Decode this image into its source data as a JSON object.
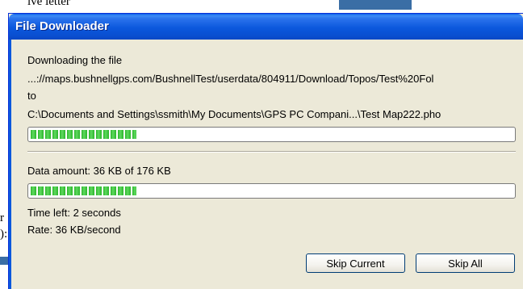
{
  "window": {
    "title": "File Downloader"
  },
  "background": {
    "text_top": "ive letter",
    "text_mid": "r",
    "text_mid2": "):"
  },
  "download": {
    "heading": "Downloading the file",
    "source_url": "...://maps.bushnellgps.com/BushnellTest/userdata/804911/Download/Topos/Test%20Fol",
    "to_label": "to",
    "destination": "C:\\Documents and Settings\\ssmith\\My Documents\\GPS PC Compani...\\Test Map222.pho",
    "file_progress": 0.22
  },
  "stats": {
    "data_amount": "Data amount: 36 KB of 176 KB",
    "amount_progress": 0.22,
    "time_left": "Time left: 2 seconds",
    "rate": "Rate: 36 KB/second"
  },
  "buttons": {
    "skip_current": "Skip Current",
    "skip_all": "Skip All"
  },
  "colors": {
    "titlebar": "#0a58dd",
    "progress_green": "#2bb52b",
    "window_face": "#ece9d8"
  }
}
